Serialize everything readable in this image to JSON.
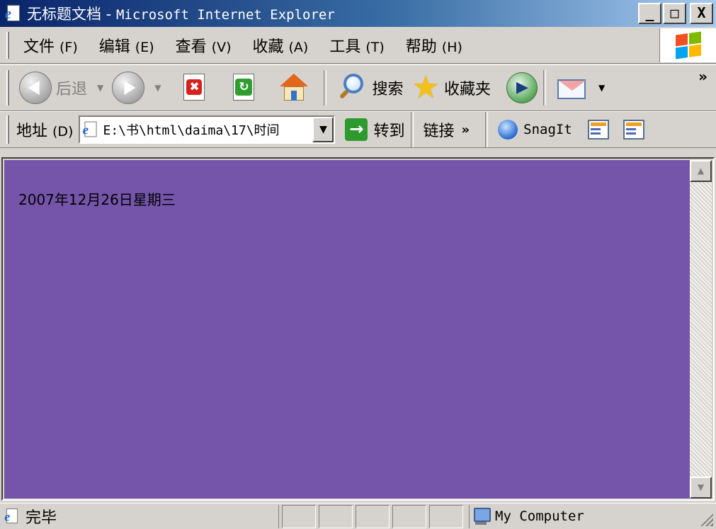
{
  "window": {
    "title_cn": "无标题文档",
    "title_sep": " - ",
    "title_app": "Microsoft Internet Explorer",
    "min_glyph": "_",
    "max_glyph": "□",
    "close_glyph": "X"
  },
  "menu": {
    "items": [
      {
        "label": "文件",
        "key": "(F)"
      },
      {
        "label": "编辑",
        "key": "(E)"
      },
      {
        "label": "查看",
        "key": "(V)"
      },
      {
        "label": "收藏",
        "key": "(A)"
      },
      {
        "label": "工具",
        "key": "(T)"
      },
      {
        "label": "帮助",
        "key": "(H)"
      }
    ]
  },
  "toolbar": {
    "back_label": "后退",
    "search_label": "搜索",
    "favorites_label": "收藏夹",
    "more_glyph": "»",
    "dropdown_glyph": "▼",
    "stop_glyph": "✖",
    "refresh_glyph": "↻"
  },
  "address": {
    "label": "地址",
    "key": "(D)",
    "value": "E:\\书\\html\\daima\\17\\时间",
    "dropdown_glyph": "▼",
    "go_glyph": "→",
    "go_label": "转到",
    "links_label": "链接",
    "links_glyph": "»",
    "snagit_label": "SnagIt"
  },
  "content": {
    "date_text": "2007年12月26日星期三",
    "background": "#7555aa"
  },
  "scrollbar": {
    "up_glyph": "▲",
    "down_glyph": "▼"
  },
  "status": {
    "text": "完毕",
    "zone": "My Computer"
  }
}
